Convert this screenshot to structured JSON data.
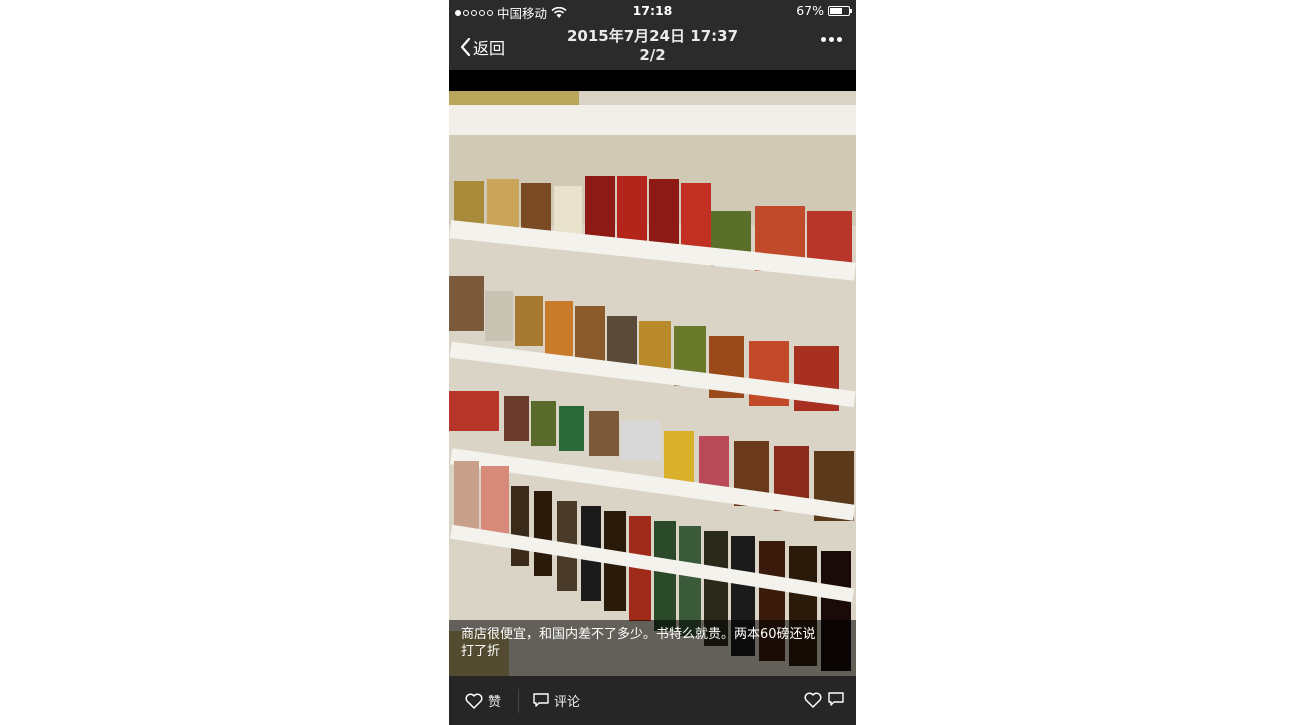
{
  "status_bar": {
    "carrier": "中国移动",
    "time": "17:18",
    "battery": "67%",
    "battery_level": 0.67
  },
  "nav": {
    "back_label": "返回",
    "title_date": "2015年7月24日 17:37",
    "title_index": "2/2"
  },
  "photo": {
    "caption_line1": "商店很便宜，和国内差不了多少。书特么就贵。两本60磅还说",
    "caption_line2": "打了折"
  },
  "bottom_bar": {
    "like_label": "赞",
    "comment_label": "评论"
  }
}
